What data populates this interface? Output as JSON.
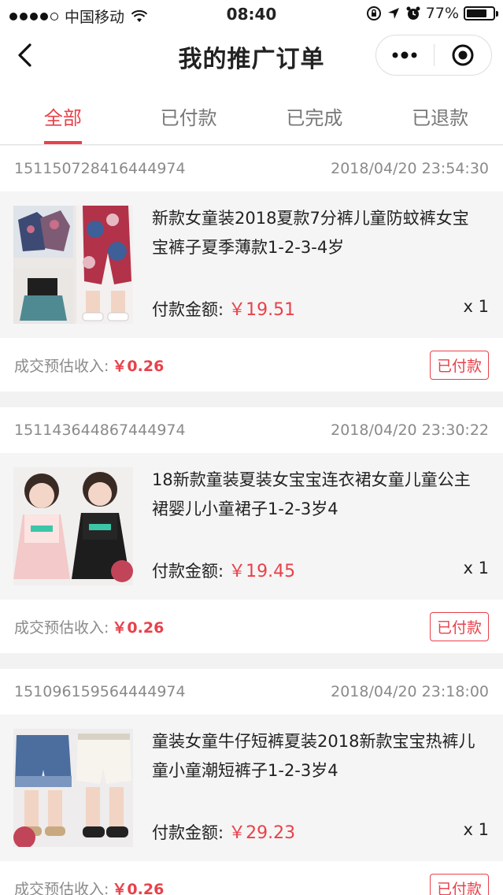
{
  "status_bar": {
    "carrier": "中国移动",
    "time": "08:40",
    "battery": "77%",
    "battery_level": 0.77
  },
  "nav": {
    "title": "我的推广订单"
  },
  "tabs": [
    {
      "label": "全部",
      "active": true
    },
    {
      "label": "已付款",
      "active": false
    },
    {
      "label": "已完成",
      "active": false
    },
    {
      "label": "已退款",
      "active": false
    }
  ],
  "orders": [
    {
      "order_id": "151150728416444974",
      "datetime": "2018/04/20 23:54:30",
      "title": "新款女童装2018夏款7分裤儿童防蚊裤女宝宝裤子夏季薄款1-2-3-4岁",
      "pay_label": "付款金额:",
      "price": "￥19.51",
      "qty": "x 1",
      "income_label": "成交预估收入:",
      "income": "￥0.26",
      "status": "已付款"
    },
    {
      "order_id": "151143644867444974",
      "datetime": "2018/04/20 23:30:22",
      "title": "18新款童装夏装女宝宝连衣裙女童儿童公主裙婴儿小童裙子1-2-3岁4",
      "pay_label": "付款金额:",
      "price": "￥19.45",
      "qty": "x 1",
      "income_label": "成交预估收入:",
      "income": "￥0.26",
      "status": "已付款"
    },
    {
      "order_id": "151096159564444974",
      "datetime": "2018/04/20 23:18:00",
      "title": "童装女童牛仔短裤夏装2018新款宝宝热裤儿童小童潮短裤子1-2-3岁4",
      "pay_label": "付款金额:",
      "price": "￥29.23",
      "qty": "x 1",
      "income_label": "成交预估收入:",
      "income": "￥0.26",
      "status": "已付款"
    }
  ],
  "colors": {
    "accent": "#e8414a",
    "muted": "#8a8a8a",
    "bg": "#f2f2f2"
  }
}
